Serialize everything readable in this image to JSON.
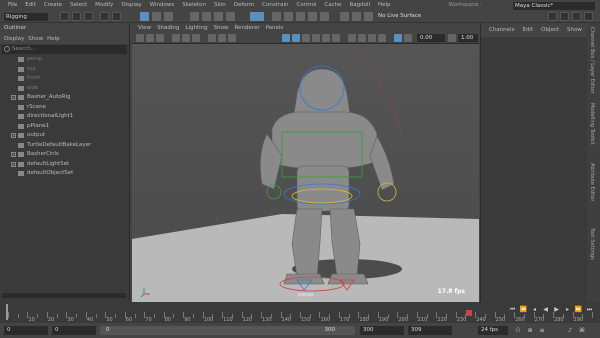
{
  "menubar": {
    "items": [
      "File",
      "Edit",
      "Create",
      "Select",
      "Modify",
      "Display",
      "Windows",
      "Skeleton",
      "Skin",
      "Deform",
      "Constrain",
      "Control",
      "Cache",
      "Ragdoll",
      "Help"
    ],
    "workspace_label": "Workspace :",
    "workspace_value": "Maya Classic*"
  },
  "status": {
    "mode": "Rigging",
    "no_live": "No Live Surface"
  },
  "outliner": {
    "title": "Outliner",
    "menu": [
      "Display",
      "Show",
      "Help"
    ],
    "search_placeholder": "Search...",
    "items": [
      {
        "label": "persp",
        "dim": true,
        "expand": false
      },
      {
        "label": "top",
        "dim": true,
        "expand": false
      },
      {
        "label": "front",
        "dim": true,
        "expand": false
      },
      {
        "label": "side",
        "dim": true,
        "expand": false
      },
      {
        "label": "Basher_AutoRig",
        "dim": false,
        "expand": true
      },
      {
        "label": "rScene",
        "dim": false,
        "expand": false
      },
      {
        "label": "directionalLight1",
        "dim": false,
        "expand": false
      },
      {
        "label": "pPlane1",
        "dim": false,
        "expand": false
      },
      {
        "label": "output",
        "dim": false,
        "expand": true
      },
      {
        "label": "TurtleDefaultBakeLayer",
        "dim": false,
        "expand": false
      },
      {
        "label": "BasherCtrls",
        "dim": false,
        "expand": true
      },
      {
        "label": "defaultLightSet",
        "dim": false,
        "expand": true
      },
      {
        "label": "defaultObjectSet",
        "dim": false,
        "expand": false
      }
    ]
  },
  "viewport": {
    "menu": [
      "View",
      "Shading",
      "Lighting",
      "Show",
      "Renderer",
      "Panels"
    ],
    "value_a": "0.00",
    "value_b": "1.00",
    "camera": "persp",
    "fps": "17.8 fps"
  },
  "channelbox": {
    "menu": [
      "Channels",
      "Edit",
      "Object",
      "Show"
    ]
  },
  "side_tabs": [
    "Channel Box / Layer Editor",
    "Modelling Toolkit",
    "Attribute Editor",
    "Tool Settings"
  ],
  "timeline": {
    "ticks": [
      "5",
      "10",
      "15",
      "20",
      "25",
      "30",
      "35",
      "40",
      "45",
      "50",
      "55",
      "60",
      "65",
      "70",
      "75",
      "80",
      "85",
      "90",
      "95",
      "100",
      "105",
      "110",
      "115",
      "120",
      "125",
      "130",
      "135",
      "140",
      "145",
      "150",
      "155",
      "160",
      "165",
      "170",
      "175",
      "180",
      "185",
      "190",
      "195",
      "200",
      "205",
      "210",
      "215",
      "220",
      "225",
      "230",
      "235",
      "240",
      "245",
      "250",
      "255",
      "260",
      "265",
      "270",
      "275",
      "280",
      "285",
      "290",
      "295"
    ],
    "current": "0"
  },
  "range": {
    "start": "0",
    "inner_start": "0",
    "slider_start": "0",
    "slider_end": "300",
    "inner_end": "300",
    "end": "309",
    "fps": "24 fps"
  }
}
